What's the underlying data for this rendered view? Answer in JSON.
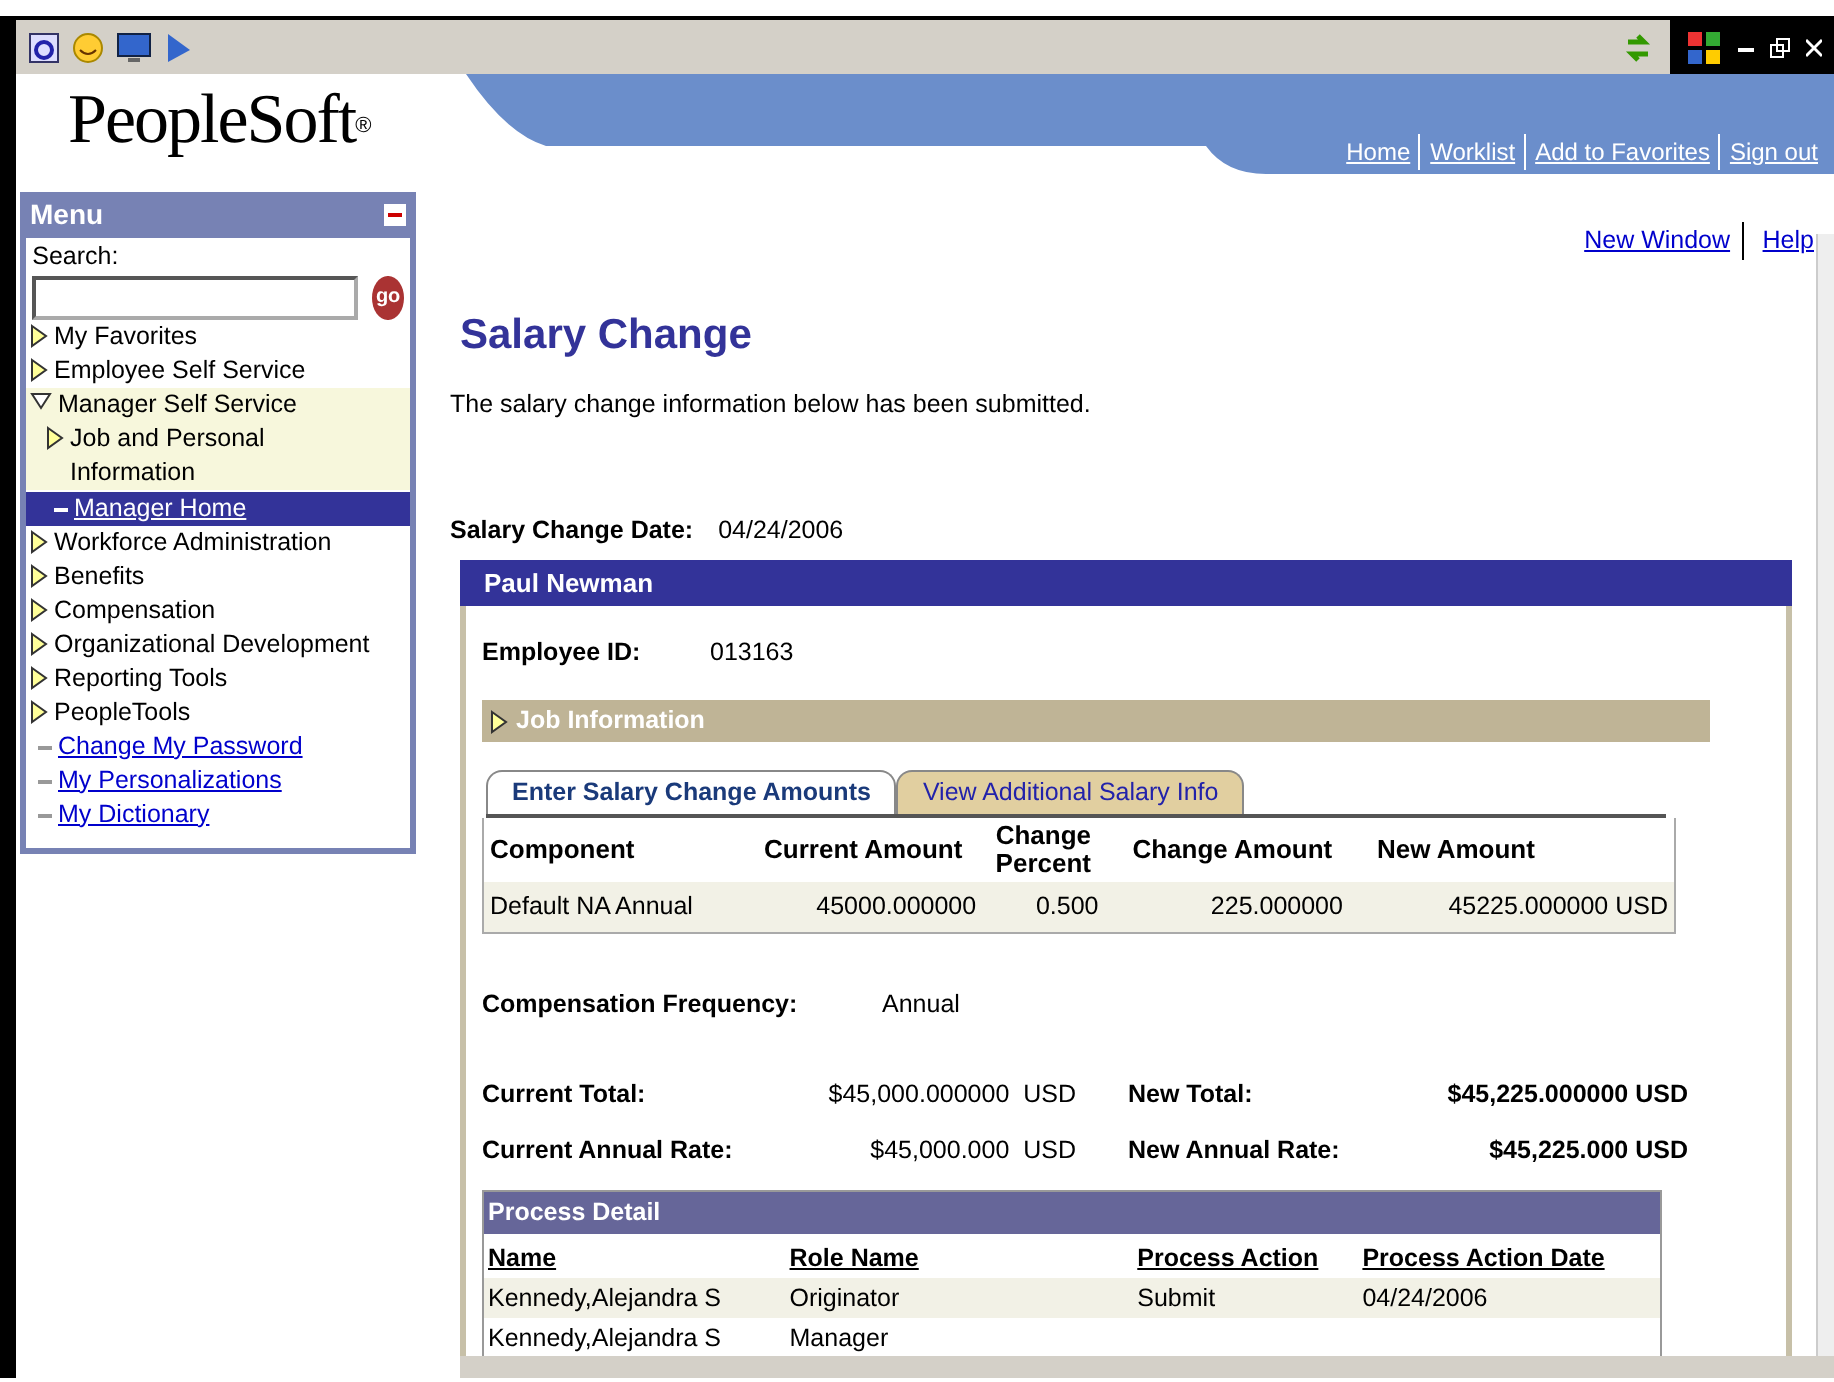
{
  "header": {
    "logo": "PeopleSoft",
    "logo_mark": "®",
    "links": [
      "Home",
      "Worklist",
      "Add to Favorites",
      "Sign out"
    ]
  },
  "menu": {
    "title": "Menu",
    "search_label": "Search:",
    "go_label": "go",
    "items": [
      {
        "kind": "folder",
        "label": "My Favorites",
        "expanded": false
      },
      {
        "kind": "folder",
        "label": "Employee Self Service",
        "expanded": false
      },
      {
        "kind": "folder",
        "label": "Manager Self Service",
        "expanded": true,
        "children": [
          {
            "kind": "folder",
            "label": "Job and Personal Information",
            "expanded": false
          },
          {
            "kind": "link",
            "label": "Manager Home",
            "selected": true
          }
        ]
      },
      {
        "kind": "folder",
        "label": "Workforce Administration",
        "expanded": false
      },
      {
        "kind": "folder",
        "label": "Benefits",
        "expanded": false
      },
      {
        "kind": "folder",
        "label": "Compensation",
        "expanded": false
      },
      {
        "kind": "folder",
        "label": "Organizational Development",
        "expanded": false
      },
      {
        "kind": "folder",
        "label": "Reporting Tools",
        "expanded": false
      },
      {
        "kind": "folder",
        "label": "PeopleTools",
        "expanded": false
      },
      {
        "kind": "link",
        "label": "Change My Password",
        "selected": false
      },
      {
        "kind": "link",
        "label": "My Personalizations",
        "selected": false
      },
      {
        "kind": "link",
        "label": "My Dictionary",
        "selected": false
      }
    ]
  },
  "top_links": [
    "New Window",
    "Help"
  ],
  "page_title": "Salary Change",
  "message": "The salary change information below has been submitted.",
  "change_date": {
    "label": "Salary Change Date:",
    "value": "04/24/2006"
  },
  "employee": {
    "name": "Paul Newman",
    "id_label": "Employee ID:",
    "id": "013163",
    "job_section": {
      "label": "Job Information",
      "expanded": false
    },
    "tabs": [
      {
        "label": "Enter Salary Change Amounts",
        "selected": true
      },
      {
        "label": "View Additional Salary Info",
        "selected": false
      }
    ],
    "table": {
      "columns": [
        "Component",
        "Current Amount",
        "Change Percent",
        "Change Amount",
        "New Amount"
      ],
      "rows": [
        [
          "Default NA Annual",
          "45000.000000",
          "0.500",
          "225.000000",
          "45225.000000 USD"
        ]
      ]
    },
    "frequency": {
      "label": "Compensation Frequency:",
      "value": "Annual"
    },
    "totals": [
      {
        "label": "Current Total:",
        "value": "$45,000.000000  USD",
        "new_label": "New Total:",
        "new_value": "$45,225.000000 USD"
      },
      {
        "label": "Current Annual Rate:",
        "value": "$45,000.000  USD",
        "new_label": "New Annual Rate:",
        "new_value": "$45,225.000 USD"
      }
    ],
    "process": {
      "title": "Process Detail",
      "columns": [
        "Name",
        "Role Name",
        "Process Action",
        "Process Action Date"
      ],
      "rows": [
        [
          "Kennedy,Alejandra S",
          "Originator",
          "Submit",
          "04/24/2006"
        ],
        [
          "Kennedy,Alejandra S",
          "Manager",
          "",
          ""
        ]
      ]
    }
  }
}
